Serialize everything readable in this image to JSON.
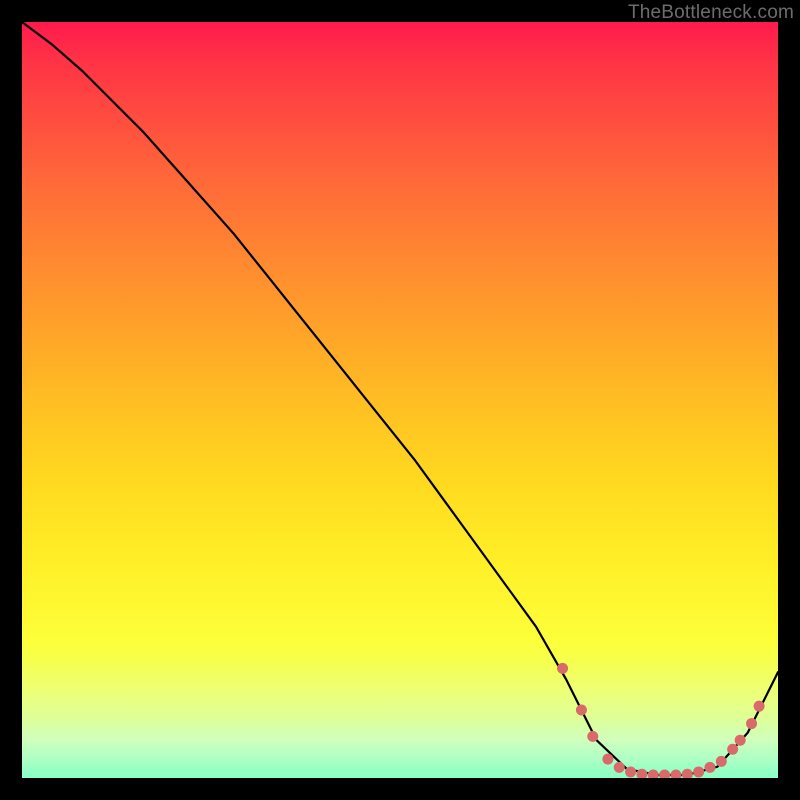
{
  "watermark": "TheBottleneck.com",
  "chart_data": {
    "type": "line",
    "title": "",
    "xlabel": "",
    "ylabel": "",
    "xlim": [
      0,
      100
    ],
    "ylim": [
      0,
      100
    ],
    "grid": false,
    "legend": false,
    "series": [
      {
        "name": "curve",
        "color": "#000000",
        "x": [
          0,
          4,
          8,
          12,
          16,
          20,
          24,
          28,
          32,
          36,
          40,
          44,
          48,
          52,
          56,
          60,
          64,
          68,
          72,
          74,
          76,
          80,
          84,
          88,
          92,
          96,
          100
        ],
        "y": [
          100,
          97,
          93.5,
          89.5,
          85.5,
          81,
          76.5,
          72,
          67,
          62,
          57,
          52,
          47,
          42,
          36.5,
          31,
          25.5,
          20,
          13,
          9,
          5,
          1.2,
          0.4,
          0.4,
          1.5,
          6,
          14
        ]
      }
    ],
    "markers": [
      {
        "name": "curve-dots",
        "color": "#d86a6a",
        "radius": 5.5,
        "points": [
          {
            "x": 71.5,
            "y": 14.5
          },
          {
            "x": 74.0,
            "y": 9.0
          },
          {
            "x": 75.5,
            "y": 5.5
          },
          {
            "x": 77.5,
            "y": 2.5
          },
          {
            "x": 79.0,
            "y": 1.4
          },
          {
            "x": 80.5,
            "y": 0.8
          },
          {
            "x": 82.0,
            "y": 0.5
          },
          {
            "x": 83.5,
            "y": 0.4
          },
          {
            "x": 85.0,
            "y": 0.4
          },
          {
            "x": 86.5,
            "y": 0.4
          },
          {
            "x": 88.0,
            "y": 0.5
          },
          {
            "x": 89.5,
            "y": 0.8
          },
          {
            "x": 91.0,
            "y": 1.4
          },
          {
            "x": 92.5,
            "y": 2.2
          },
          {
            "x": 94.0,
            "y": 3.8
          },
          {
            "x": 95.0,
            "y": 5.0
          },
          {
            "x": 96.5,
            "y": 7.2
          },
          {
            "x": 97.5,
            "y": 9.5
          }
        ]
      }
    ],
    "background_gradient": {
      "top": "#ff1a4d",
      "mid_upper": "#ff8a30",
      "mid": "#ffdc20",
      "mid_lower": "#edff66",
      "bottom": "#00ff7a"
    }
  }
}
